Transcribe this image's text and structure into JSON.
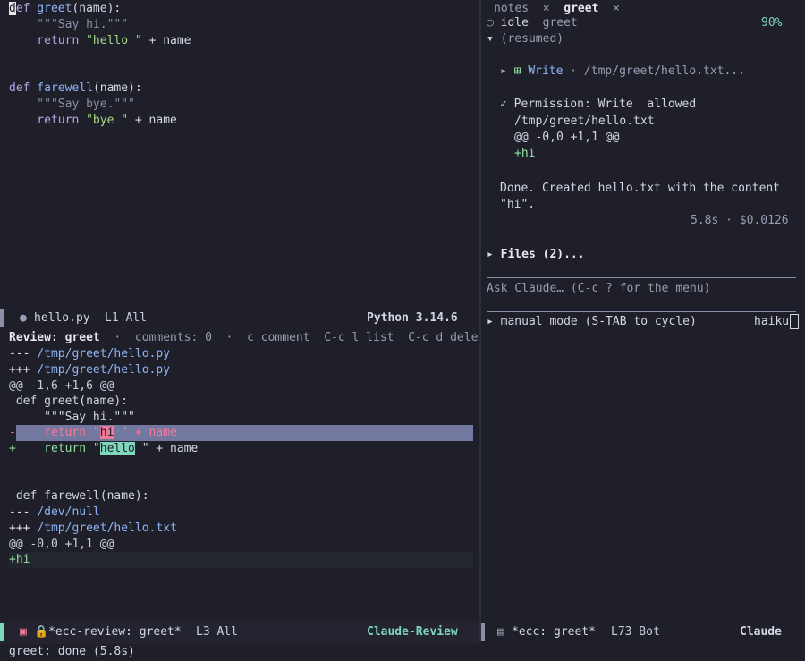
{
  "editor_top": {
    "lines": [
      {
        "kw": "def",
        "fn": " greet",
        "rest": "(name):"
      },
      {
        "doc": "    \"\"\"Say hi.\"\"\""
      },
      {
        "kw2": "    return ",
        "str": "\"hello \"",
        "rest2": " + name"
      },
      {
        "kw": "def",
        "fn": " farewell",
        "rest": "(name):"
      },
      {
        "doc": "    \"\"\"Say bye.\"\"\""
      },
      {
        "kw2": "    return ",
        "str": "\"bye \"",
        "rest2": " + name"
      }
    ]
  },
  "modeline_top": {
    "file": "hello.py",
    "pos": "L1 All",
    "mode": "Python 3.14.6"
  },
  "review": {
    "header_label": "Review: greet",
    "header_rest": "  ·  comments: 0  ·  c comment  C-c l list  C-c d dele",
    "file1_minus_prefix": "--- ",
    "file1_minus_path": "/tmp/greet/hello.py",
    "file1_plus_prefix": "+++ ",
    "file1_plus_path": "/tmp/greet/hello.py",
    "hunk1": "@@ -1,6 +1,6 @@",
    "ctx1": " def greet(name):",
    "ctx2": "     \"\"\"Say hi.\"\"\"",
    "del_prefix": "-    return \"",
    "del_word": "hi",
    "del_suffix": " \" + name",
    "add_prefix": "+    return \"",
    "add_word": "hello",
    "add_suffix": " \" + name",
    "ctx3": " def farewell(name):",
    "file2_minus_prefix": "--- ",
    "file2_minus_path": "/dev/null",
    "file2_plus_prefix": "+++ ",
    "file2_plus_path": "/tmp/greet/hello.txt",
    "hunk2": "@@ -0,0 +1,1 @@",
    "add_line": "+hi"
  },
  "modeline_bottom": {
    "buffer": "*ecc-review: greet*",
    "pos": "L3 All",
    "mode": "Claude-Review"
  },
  "echo_area": "greet: done (5.8s)",
  "right": {
    "tabs": [
      {
        "label": "notes",
        "close": "×"
      },
      {
        "label": "greet",
        "close": "×"
      }
    ],
    "status_state": "idle",
    "status_session": "greet",
    "status_pct": "90%",
    "resumed": "(resumed)",
    "tool_name": "Write",
    "tool_path": " · /tmp/greet/hello.txt...",
    "perm_label": "Permission: Write",
    "perm_status": "allowed",
    "perm_path": "/tmp/greet/hello.txt",
    "perm_hunk": "@@ -0,0 +1,1 @@",
    "perm_add": "+hi",
    "done_line1": "Done. Created hello.txt with the content",
    "done_line2": "\"hi\".",
    "cost": "5.8s · $0.0126",
    "files": "Files (2)...",
    "prompt_placeholder": "Ask Claude… (C-c ? for the menu)",
    "mode_line": "manual mode (S-TAB to cycle)",
    "model": "haiku"
  },
  "modeline_right": {
    "buffer": "*ecc: greet*",
    "pos": "L73 Bot",
    "mode": "Claude"
  },
  "colors": {
    "background": "#1e1f29",
    "accent_teal": "#7ed6bb",
    "accent_purple": "#b4a7ec",
    "deletion": "#ef7a9a"
  }
}
